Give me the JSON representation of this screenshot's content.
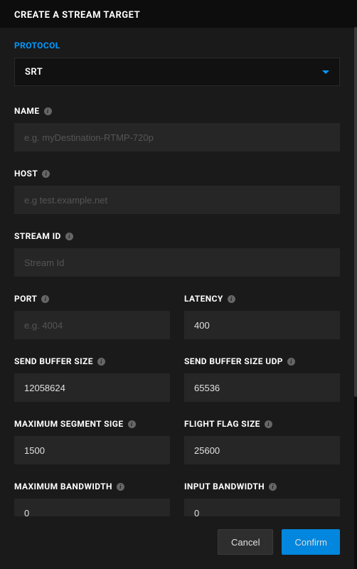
{
  "header": {
    "title": "CREATE A STREAM TARGET"
  },
  "protocol": {
    "label": "PROTOCOL",
    "value": "SRT"
  },
  "fields": {
    "name": {
      "label": "NAME",
      "placeholder": "e.g. myDestination-RTMP-720p",
      "value": ""
    },
    "host": {
      "label": "HOST",
      "placeholder": "e.g test.example.net",
      "value": ""
    },
    "streamId": {
      "label": "STREAM ID",
      "placeholder": "Stream Id",
      "value": ""
    },
    "port": {
      "label": "PORT",
      "placeholder": "e.g. 4004",
      "value": ""
    },
    "latency": {
      "label": "LATENCY",
      "placeholder": "",
      "value": "400"
    },
    "sendBuf": {
      "label": "SEND BUFFER SIZE",
      "placeholder": "",
      "value": "12058624"
    },
    "sendBufUdp": {
      "label": "SEND BUFFER SIZE UDP",
      "placeholder": "",
      "value": "65536"
    },
    "maxSeg": {
      "label": "MAXIMUM SEGMENT SIGE",
      "placeholder": "",
      "value": "1500"
    },
    "flightFlag": {
      "label": "FLIGHT FLAG SIZE",
      "placeholder": "",
      "value": "25600"
    },
    "maxBw": {
      "label": "MAXIMUM BANDWIDTH",
      "placeholder": "",
      "value": "0"
    },
    "inputBw": {
      "label": "INPUT BANDWIDTH",
      "placeholder": "",
      "value": "0"
    }
  },
  "footer": {
    "cancel": "Cancel",
    "confirm": "Confirm"
  }
}
